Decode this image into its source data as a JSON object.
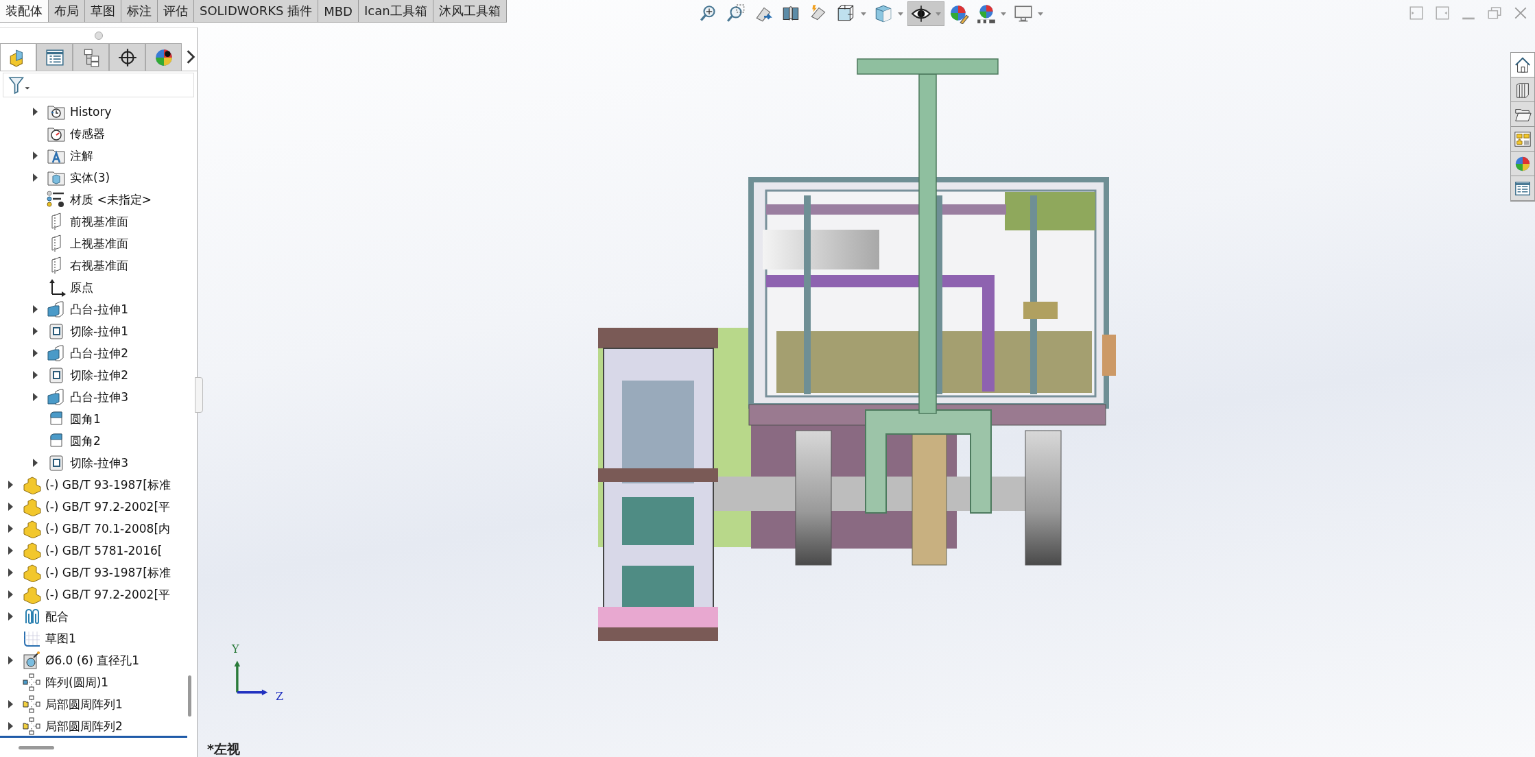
{
  "command_tabs": [
    {
      "label": "装配体",
      "selected": true
    },
    {
      "label": "布局",
      "selected": false
    },
    {
      "label": "草图",
      "selected": false
    },
    {
      "label": "标注",
      "selected": false
    },
    {
      "label": "评估",
      "selected": false
    },
    {
      "label": "SOLIDWORKS 插件",
      "selected": false
    },
    {
      "label": "MBD",
      "selected": false
    },
    {
      "label": "Ican工具箱",
      "selected": false
    },
    {
      "label": "沐风工具箱",
      "selected": false
    }
  ],
  "view_toolbar": [
    {
      "kind": "zoom-fit",
      "dropdown": false,
      "selected": false
    },
    {
      "kind": "zoom-area",
      "dropdown": false,
      "selected": false
    },
    {
      "kind": "previous-view",
      "dropdown": false,
      "selected": false
    },
    {
      "kind": "section",
      "dropdown": false,
      "selected": false
    },
    {
      "kind": "dynamic-annotation",
      "dropdown": false,
      "selected": false
    },
    {
      "kind": "view-orientation",
      "dropdown": true,
      "selected": false
    },
    {
      "kind": "display-style",
      "dropdown": true,
      "selected": false
    },
    {
      "kind": "hide-show",
      "dropdown": true,
      "selected": true
    },
    {
      "kind": "edit-appearance",
      "dropdown": false,
      "selected": false
    },
    {
      "kind": "scenes",
      "dropdown": true,
      "selected": false
    },
    {
      "kind": "view-settings",
      "dropdown": true,
      "selected": false
    }
  ],
  "panel_tabs": [
    {
      "kind": "feature-tree",
      "selected": true
    },
    {
      "kind": "property",
      "selected": false
    },
    {
      "kind": "configuration",
      "selected": false
    },
    {
      "kind": "dimxpert",
      "selected": false
    },
    {
      "kind": "display",
      "selected": false
    }
  ],
  "feature_tree": {
    "continued_children": [
      {
        "label": "History",
        "kind": "history",
        "expandable": true
      },
      {
        "label": "传感器",
        "kind": "sensor",
        "expandable": false
      },
      {
        "label": "注解",
        "kind": "annotation",
        "expandable": true
      },
      {
        "label": "实体(3)",
        "kind": "solid",
        "expandable": true
      },
      {
        "label": "材质 <未指定>",
        "kind": "material",
        "expandable": false
      },
      {
        "label": "前视基准面",
        "kind": "plane",
        "expandable": false
      },
      {
        "label": "上视基准面",
        "kind": "plane",
        "expandable": false
      },
      {
        "label": "右视基准面",
        "kind": "plane",
        "expandable": false
      },
      {
        "label": "原点",
        "kind": "origin",
        "expandable": false
      },
      {
        "label": "凸台-拉伸1",
        "kind": "boss",
        "expandable": true
      },
      {
        "label": "切除-拉伸1",
        "kind": "cut",
        "expandable": true
      },
      {
        "label": "凸台-拉伸2",
        "kind": "boss",
        "expandable": true
      },
      {
        "label": "切除-拉伸2",
        "kind": "cut",
        "expandable": true
      },
      {
        "label": "凸台-拉伸3",
        "kind": "boss",
        "expandable": true
      },
      {
        "label": "圆角1",
        "kind": "fillet",
        "expandable": false
      },
      {
        "label": "圆角2",
        "kind": "fillet",
        "expandable": false
      },
      {
        "label": "切除-拉伸3",
        "kind": "cut",
        "expandable": true
      }
    ],
    "items": [
      {
        "label": "(-) GB/T 93-1987[标准",
        "kind": "part",
        "expandable": true
      },
      {
        "label": "(-) GB/T 97.2-2002[平",
        "kind": "part",
        "expandable": true
      },
      {
        "label": "(-) GB/T 70.1-2008[内",
        "kind": "part",
        "expandable": true
      },
      {
        "label": "(-) GB/T 5781-2016[",
        "kind": "part",
        "expandable": true
      },
      {
        "label": "(-) GB/T 93-1987[标准",
        "kind": "part",
        "expandable": true
      },
      {
        "label": "(-) GB/T 97.2-2002[平",
        "kind": "part",
        "expandable": true
      },
      {
        "label": "配合",
        "kind": "mates",
        "expandable": true
      },
      {
        "label": "草图1",
        "kind": "sketch",
        "expandable": false
      },
      {
        "label": "Ø6.0 (6) 直径孔1",
        "kind": "hole",
        "expandable": true
      },
      {
        "label": "阵列(圆周)1",
        "kind": "pattern",
        "expandable": false
      },
      {
        "label": "局部圆周阵列1",
        "kind": "local-pattern",
        "expandable": true
      },
      {
        "label": "局部圆周阵列2",
        "kind": "local-pattern",
        "expandable": true
      }
    ]
  },
  "task_pane": [
    {
      "kind": "home",
      "selected": true
    },
    {
      "kind": "library",
      "selected": false
    },
    {
      "kind": "file-explorer",
      "selected": false
    },
    {
      "kind": "view-palette",
      "selected": false
    },
    {
      "kind": "appearances",
      "selected": false
    },
    {
      "kind": "custom-properties",
      "selected": false
    }
  ],
  "triad": {
    "y_label": "Y",
    "z_label": "Z"
  },
  "view_name": "*左视"
}
